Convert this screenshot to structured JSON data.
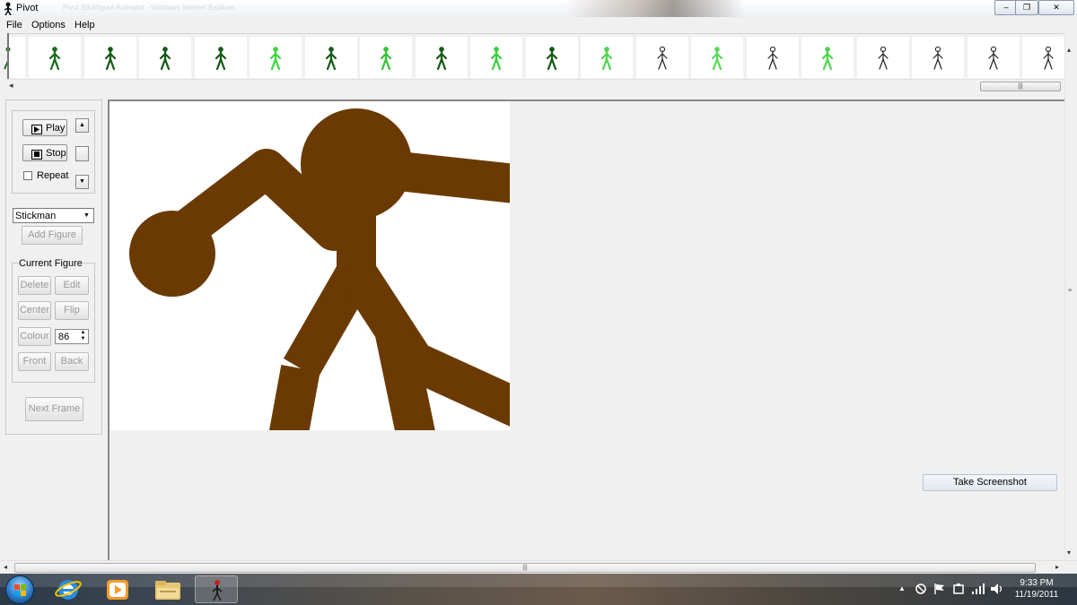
{
  "window": {
    "title": "Pivot",
    "background_title": "Pivot Stickfigure Animator - Windows Internet Explorer",
    "minimize": "–",
    "restore": "❐",
    "close": "✕"
  },
  "menu": {
    "file": "File",
    "options": "Options",
    "help": "Help"
  },
  "frames": {
    "colors": [
      "#1b6b1b",
      "#145a14",
      "#145a14",
      "#145a14",
      "#3ed63e",
      "#145a14",
      "#33c433",
      "#145a14",
      "#39cf39",
      "#145a14",
      "#4ed64e",
      "#222222",
      "#5ad85a",
      "#222222",
      "#4ed64e",
      "#222222",
      "#222222",
      "#222222",
      "#222222"
    ],
    "scroll_grip": "|||"
  },
  "controls": {
    "play_label": "Play",
    "stop_label": "Stop",
    "repeat_label": "Repeat",
    "figure_type": "Stickman",
    "add_figure_label": "Add Figure",
    "current_figure_title": "Current Figure",
    "delete_label": "Delete",
    "edit_label": "Edit",
    "center_label": "Center",
    "flip_label": "Flip",
    "colour_label": "Colour",
    "colour_value": "86",
    "front_label": "Front",
    "back_label": "Back",
    "next_frame_label": "Next Frame"
  },
  "canvas": {
    "figure_color": "#6b3a03",
    "background": "#ffffff"
  },
  "take_screenshot_label": "Take Screenshot",
  "main_scroll_grip": "|||",
  "taskbar": {
    "time": "9:33 PM",
    "date": "11/19/2011",
    "tray_arrow": "▲"
  }
}
